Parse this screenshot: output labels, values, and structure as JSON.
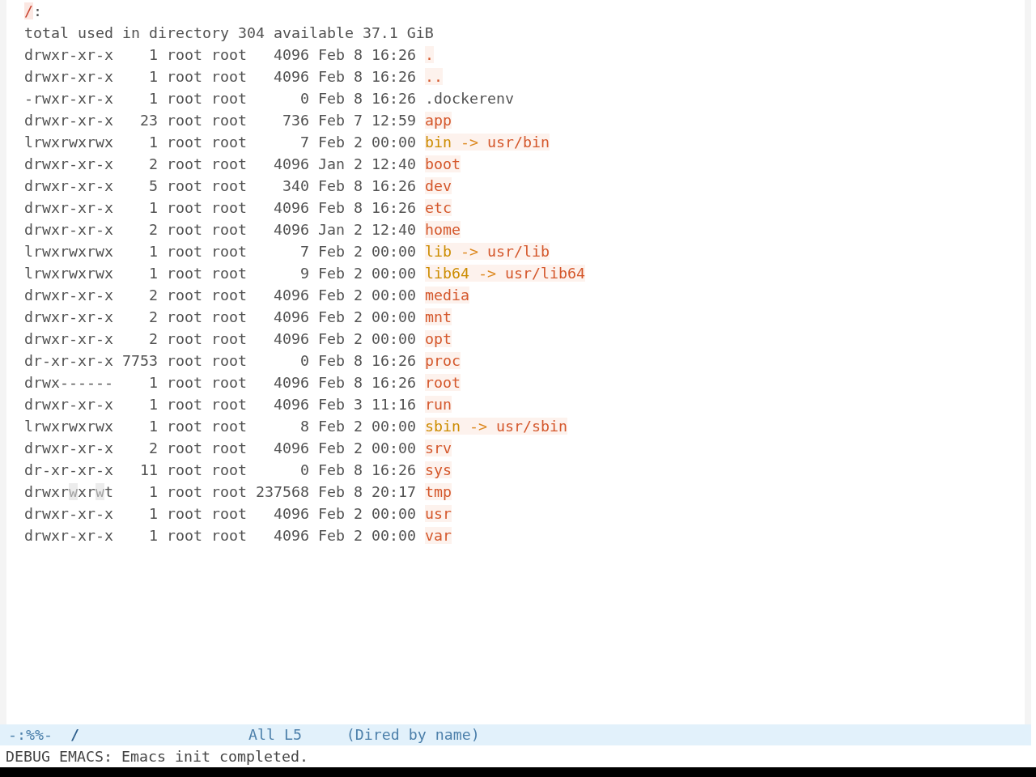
{
  "header": {
    "directory": "/",
    "suffix": ":"
  },
  "summary": "total used in directory 304 available 37.1 GiB",
  "entries": [
    {
      "kind": "dir",
      "permissions": [
        {
          "text": "drwxr-xr-x",
          "highlighted": false
        }
      ],
      "links": "1",
      "owner": "root",
      "group": "root",
      "size": "4096",
      "month": "Feb",
      "day": "8",
      "time": "16:26",
      "name": "."
    },
    {
      "kind": "dir",
      "permissions": [
        {
          "text": "drwxr-xr-x",
          "highlighted": false
        }
      ],
      "links": "1",
      "owner": "root",
      "group": "root",
      "size": "4096",
      "month": "Feb",
      "day": "8",
      "time": "16:26",
      "name": ".."
    },
    {
      "kind": "file",
      "permissions": [
        {
          "text": "-rwxr-xr-x",
          "highlighted": false
        }
      ],
      "links": "1",
      "owner": "root",
      "group": "root",
      "size": "0",
      "month": "Feb",
      "day": "8",
      "time": "16:26",
      "name": ".dockerenv"
    },
    {
      "kind": "dir",
      "permissions": [
        {
          "text": "drwxr-xr-x",
          "highlighted": false
        }
      ],
      "links": "23",
      "owner": "root",
      "group": "root",
      "size": "736",
      "month": "Feb",
      "day": "7",
      "time": "12:59",
      "name": "app"
    },
    {
      "kind": "symlink",
      "permissions": [
        {
          "text": "lrwxrwxrwx",
          "highlighted": false
        }
      ],
      "links": "1",
      "owner": "root",
      "group": "root",
      "size": "7",
      "month": "Feb",
      "day": "2",
      "time": "00:00",
      "name": "bin",
      "arrow": "->",
      "target": "usr/bin"
    },
    {
      "kind": "dir",
      "permissions": [
        {
          "text": "drwxr-xr-x",
          "highlighted": false
        }
      ],
      "links": "2",
      "owner": "root",
      "group": "root",
      "size": "4096",
      "month": "Jan",
      "day": "2",
      "time": "12:40",
      "name": "boot"
    },
    {
      "kind": "dir",
      "permissions": [
        {
          "text": "drwxr-xr-x",
          "highlighted": false
        }
      ],
      "links": "5",
      "owner": "root",
      "group": "root",
      "size": "340",
      "month": "Feb",
      "day": "8",
      "time": "16:26",
      "name": "dev"
    },
    {
      "kind": "dir",
      "permissions": [
        {
          "text": "drwxr-xr-x",
          "highlighted": false
        }
      ],
      "links": "1",
      "owner": "root",
      "group": "root",
      "size": "4096",
      "month": "Feb",
      "day": "8",
      "time": "16:26",
      "name": "etc"
    },
    {
      "kind": "dir",
      "permissions": [
        {
          "text": "drwxr-xr-x",
          "highlighted": false
        }
      ],
      "links": "2",
      "owner": "root",
      "group": "root",
      "size": "4096",
      "month": "Jan",
      "day": "2",
      "time": "12:40",
      "name": "home"
    },
    {
      "kind": "symlink",
      "permissions": [
        {
          "text": "lrwxrwxrwx",
          "highlighted": false
        }
      ],
      "links": "1",
      "owner": "root",
      "group": "root",
      "size": "7",
      "month": "Feb",
      "day": "2",
      "time": "00:00",
      "name": "lib",
      "arrow": "->",
      "target": "usr/lib"
    },
    {
      "kind": "symlink",
      "permissions": [
        {
          "text": "lrwxrwxrwx",
          "highlighted": false
        }
      ],
      "links": "1",
      "owner": "root",
      "group": "root",
      "size": "9",
      "month": "Feb",
      "day": "2",
      "time": "00:00",
      "name": "lib64",
      "arrow": "->",
      "target": "usr/lib64"
    },
    {
      "kind": "dir",
      "permissions": [
        {
          "text": "drwxr-xr-x",
          "highlighted": false
        }
      ],
      "links": "2",
      "owner": "root",
      "group": "root",
      "size": "4096",
      "month": "Feb",
      "day": "2",
      "time": "00:00",
      "name": "media"
    },
    {
      "kind": "dir",
      "permissions": [
        {
          "text": "drwxr-xr-x",
          "highlighted": false
        }
      ],
      "links": "2",
      "owner": "root",
      "group": "root",
      "size": "4096",
      "month": "Feb",
      "day": "2",
      "time": "00:00",
      "name": "mnt"
    },
    {
      "kind": "dir",
      "permissions": [
        {
          "text": "drwxr-xr-x",
          "highlighted": false
        }
      ],
      "links": "2",
      "owner": "root",
      "group": "root",
      "size": "4096",
      "month": "Feb",
      "day": "2",
      "time": "00:00",
      "name": "opt"
    },
    {
      "kind": "dir",
      "permissions": [
        {
          "text": "dr-xr-xr-x",
          "highlighted": false
        }
      ],
      "links": "7753",
      "owner": "root",
      "group": "root",
      "size": "0",
      "month": "Feb",
      "day": "8",
      "time": "16:26",
      "name": "proc"
    },
    {
      "kind": "dir",
      "permissions": [
        {
          "text": "drwx------",
          "highlighted": false
        }
      ],
      "links": "1",
      "owner": "root",
      "group": "root",
      "size": "4096",
      "month": "Feb",
      "day": "8",
      "time": "16:26",
      "name": "root"
    },
    {
      "kind": "dir",
      "permissions": [
        {
          "text": "drwxr-xr-x",
          "highlighted": false
        }
      ],
      "links": "1",
      "owner": "root",
      "group": "root",
      "size": "4096",
      "month": "Feb",
      "day": "3",
      "time": "11:16",
      "name": "run"
    },
    {
      "kind": "symlink",
      "permissions": [
        {
          "text": "lrwxrwxrwx",
          "highlighted": false
        }
      ],
      "links": "1",
      "owner": "root",
      "group": "root",
      "size": "8",
      "month": "Feb",
      "day": "2",
      "time": "00:00",
      "name": "sbin",
      "arrow": "->",
      "target": "usr/sbin"
    },
    {
      "kind": "dir",
      "permissions": [
        {
          "text": "drwxr-xr-x",
          "highlighted": false
        }
      ],
      "links": "2",
      "owner": "root",
      "group": "root",
      "size": "4096",
      "month": "Feb",
      "day": "2",
      "time": "00:00",
      "name": "srv"
    },
    {
      "kind": "dir",
      "permissions": [
        {
          "text": "dr-xr-xr-x",
          "highlighted": false
        }
      ],
      "links": "11",
      "owner": "root",
      "group": "root",
      "size": "0",
      "month": "Feb",
      "day": "8",
      "time": "16:26",
      "name": "sys"
    },
    {
      "kind": "dir",
      "permissions": [
        {
          "text": "drwxr",
          "highlighted": false
        },
        {
          "text": "w",
          "highlighted": true
        },
        {
          "text": "xr",
          "highlighted": false
        },
        {
          "text": "w",
          "highlighted": true
        },
        {
          "text": "t",
          "highlighted": false
        }
      ],
      "links": "1",
      "owner": "root",
      "group": "root",
      "size": "237568",
      "month": "Feb",
      "day": "8",
      "time": "20:17",
      "name": "tmp"
    },
    {
      "kind": "dir",
      "permissions": [
        {
          "text": "drwxr-xr-x",
          "highlighted": false
        }
      ],
      "links": "1",
      "owner": "root",
      "group": "root",
      "size": "4096",
      "month": "Feb",
      "day": "2",
      "time": "00:00",
      "name": "usr"
    },
    {
      "kind": "dir",
      "permissions": [
        {
          "text": "drwxr-xr-x",
          "highlighted": false
        }
      ],
      "links": "1",
      "owner": "root",
      "group": "root",
      "size": "4096",
      "month": "Feb",
      "day": "2",
      "time": "00:00",
      "name": "var"
    }
  ],
  "mode_line": {
    "status": "-:%%-",
    "buffer": "/",
    "position": "All L5",
    "mode": "(Dired by name)"
  },
  "echo_area": "DEBUG EMACS: Emacs init completed."
}
